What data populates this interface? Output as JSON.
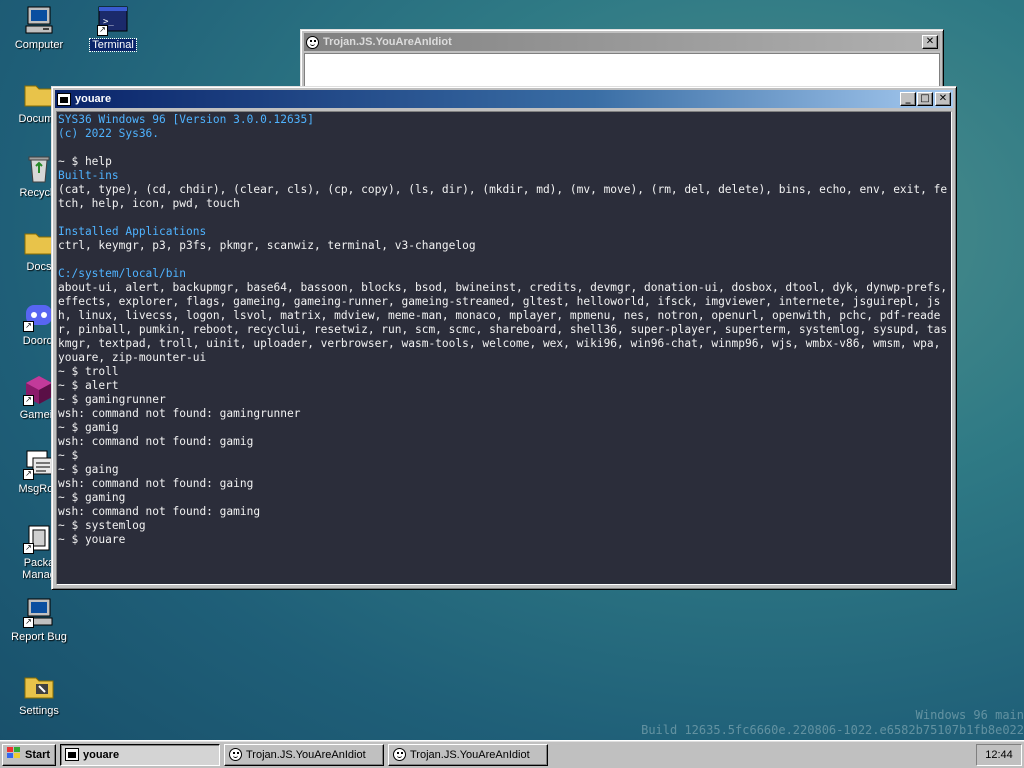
{
  "desktop": {
    "icons": [
      {
        "label": "Computer"
      },
      {
        "label": "Terminal"
      },
      {
        "label": "Docume"
      },
      {
        "label": "Recycle"
      },
      {
        "label": "Docs"
      },
      {
        "label": "Doordi"
      },
      {
        "label": "Gamein"
      },
      {
        "label": "MsgRoo"
      },
      {
        "label": "Packa",
        "label2": "Manag"
      },
      {
        "label": "Report Bug"
      },
      {
        "label": "Settings"
      }
    ]
  },
  "trojan_window": {
    "title": "Trojan.JS.YouAreAnIdiot",
    "close": "✕"
  },
  "terminal_window": {
    "title": "youare",
    "minimize": "_",
    "maximize": "□",
    "close": "✕",
    "lines": [
      {
        "text": "SYS36 Windows 96 [Version 3.0.0.12635]",
        "color": "blue"
      },
      {
        "text": "(c) 2022 Sys36.",
        "color": "blue"
      },
      {
        "text": "",
        "color": "white"
      },
      {
        "text": "~ $ help",
        "color": "white"
      },
      {
        "text": "Built-ins",
        "color": "blue"
      },
      {
        "text": "(cat, type), (cd, chdir), (clear, cls), (cp, copy), (ls, dir), (mkdir, md), (mv, move), (rm, del, delete), bins, echo, env, exit, fetch, help, icon, pwd, touch",
        "color": "white"
      },
      {
        "text": "",
        "color": "white"
      },
      {
        "text": "Installed Applications",
        "color": "blue"
      },
      {
        "text": "ctrl, keymgr, p3, p3fs, pkmgr, scanwiz, terminal, v3-changelog",
        "color": "white"
      },
      {
        "text": "",
        "color": "white"
      },
      {
        "text": "C:/system/local/bin",
        "color": "blue"
      },
      {
        "text": "about-ui, alert, backupmgr, base64, bassoon, blocks, bsod, bwineinst, credits, devmgr, donation-ui, dosbox, dtool, dyk, dynwp-prefs, effects, explorer, flags, gameing, gameing-runner, gameing-streamed, gltest, helloworld, ifsck, imgviewer, internete, jsguirepl, jsh, linux, livecss, logon, lsvol, matrix, mdview, meme-man, monaco, mplayer, mpmenu, nes, notron, openurl, openwith, pchc, pdf-reader, pinball, pumkin, reboot, recyclui, resetwiz, run, scm, scmc, shareboard, shell36, super-player, superterm, systemlog, sysupd, taskmgr, textpad, troll, uinit, uploader, verbrowser, wasm-tools, welcome, wex, wiki96, win96-chat, winmp96, wjs, wmbx-v86, wmsm, wpa, youare, zip-mounter-ui",
        "color": "white"
      },
      {
        "text": "~ $ troll",
        "color": "white"
      },
      {
        "text": "~ $ alert",
        "color": "white"
      },
      {
        "text": "~ $ gamingrunner",
        "color": "white"
      },
      {
        "text": "wsh: command not found: gamingrunner",
        "color": "white"
      },
      {
        "text": "~ $ gamig",
        "color": "white"
      },
      {
        "text": "wsh: command not found: gamig",
        "color": "white"
      },
      {
        "text": "~ $",
        "color": "white"
      },
      {
        "text": "~ $ gaing",
        "color": "white"
      },
      {
        "text": "wsh: command not found: gaing",
        "color": "white"
      },
      {
        "text": "~ $ gaming",
        "color": "white"
      },
      {
        "text": "wsh: command not found: gaming",
        "color": "white"
      },
      {
        "text": "~ $ systemlog",
        "color": "white"
      },
      {
        "text": "~ $ youare",
        "color": "white"
      }
    ]
  },
  "watermark": {
    "line1": "Windows 96 main",
    "line2": "Build 12635.5fc6660e.220806-1022.e6582b75107b1fb8e022"
  },
  "taskbar": {
    "start_label": "Start",
    "tasks": [
      {
        "label": "youare",
        "active": true
      },
      {
        "label": "Trojan.JS.YouAreAnIdiot",
        "active": false
      },
      {
        "label": "Trojan.JS.YouAreAnIdiot",
        "active": false
      }
    ],
    "clock": "12:44"
  },
  "colors": {
    "terminal_bg": "#2b2d3a",
    "terminal_blue": "#4fb3ff",
    "title_active": "#0a246a",
    "desktop": "#2f7a85"
  }
}
